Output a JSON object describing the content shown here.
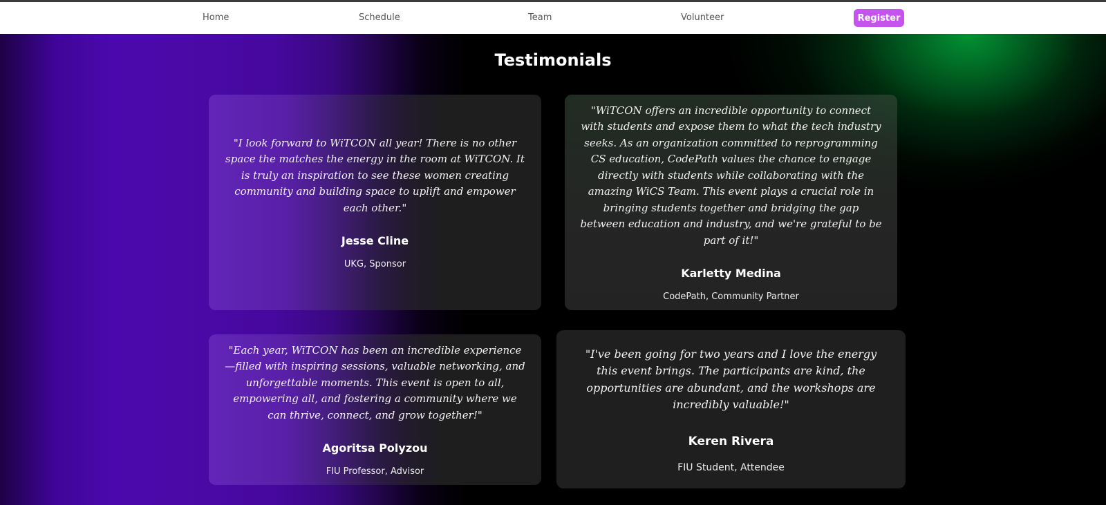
{
  "nav": {
    "items": [
      {
        "label": "Home"
      },
      {
        "label": "Schedule"
      },
      {
        "label": "Team"
      },
      {
        "label": "Volunteer"
      }
    ],
    "register_label": "Register"
  },
  "colors": {
    "register_button": "#c753ef",
    "background_purple": "#4b08ac",
    "background_green": "#02a53a"
  },
  "section": {
    "title": "Testimonials"
  },
  "testimonials": [
    {
      "quote": "\"I look forward to WiTCON all year! There is no other space the matches the energy in the room at WiTCON. It is truly an inspiration to see these women creating community and building space to uplift and empower each other.\"",
      "name": "Jesse Cline",
      "role": "UKG, Sponsor"
    },
    {
      "quote": "\"WiTCON offers an incredible opportunity to connect with students and expose them to what the tech industry seeks. As an organization committed to reprogramming CS education, CodePath values the chance to engage directly with students while collaborating with the amazing WiCS Team. This event plays a crucial role in bringing students together and bridging the gap between education and industry, and we're grateful to be part of it!\"",
      "name": "Karletty Medina",
      "role": "CodePath, Community Partner"
    },
    {
      "quote": "\"Each year, WiTCON has been an incredible experience—filled with inspiring sessions, valuable networking, and unforgettable moments. This event is open to all, empowering all, and fostering a community where we can thrive, connect, and grow together!\"",
      "name": "Agoritsa Polyzou",
      "role": "FIU Professor, Advisor"
    },
    {
      "quote": "\"I've been going for two years and I love the energy this event brings. The participants are kind, the opportunities are abundant, and the workshops are incredibly valuable!\"",
      "name": "Keren Rivera",
      "role": "FIU Student, Attendee"
    }
  ]
}
